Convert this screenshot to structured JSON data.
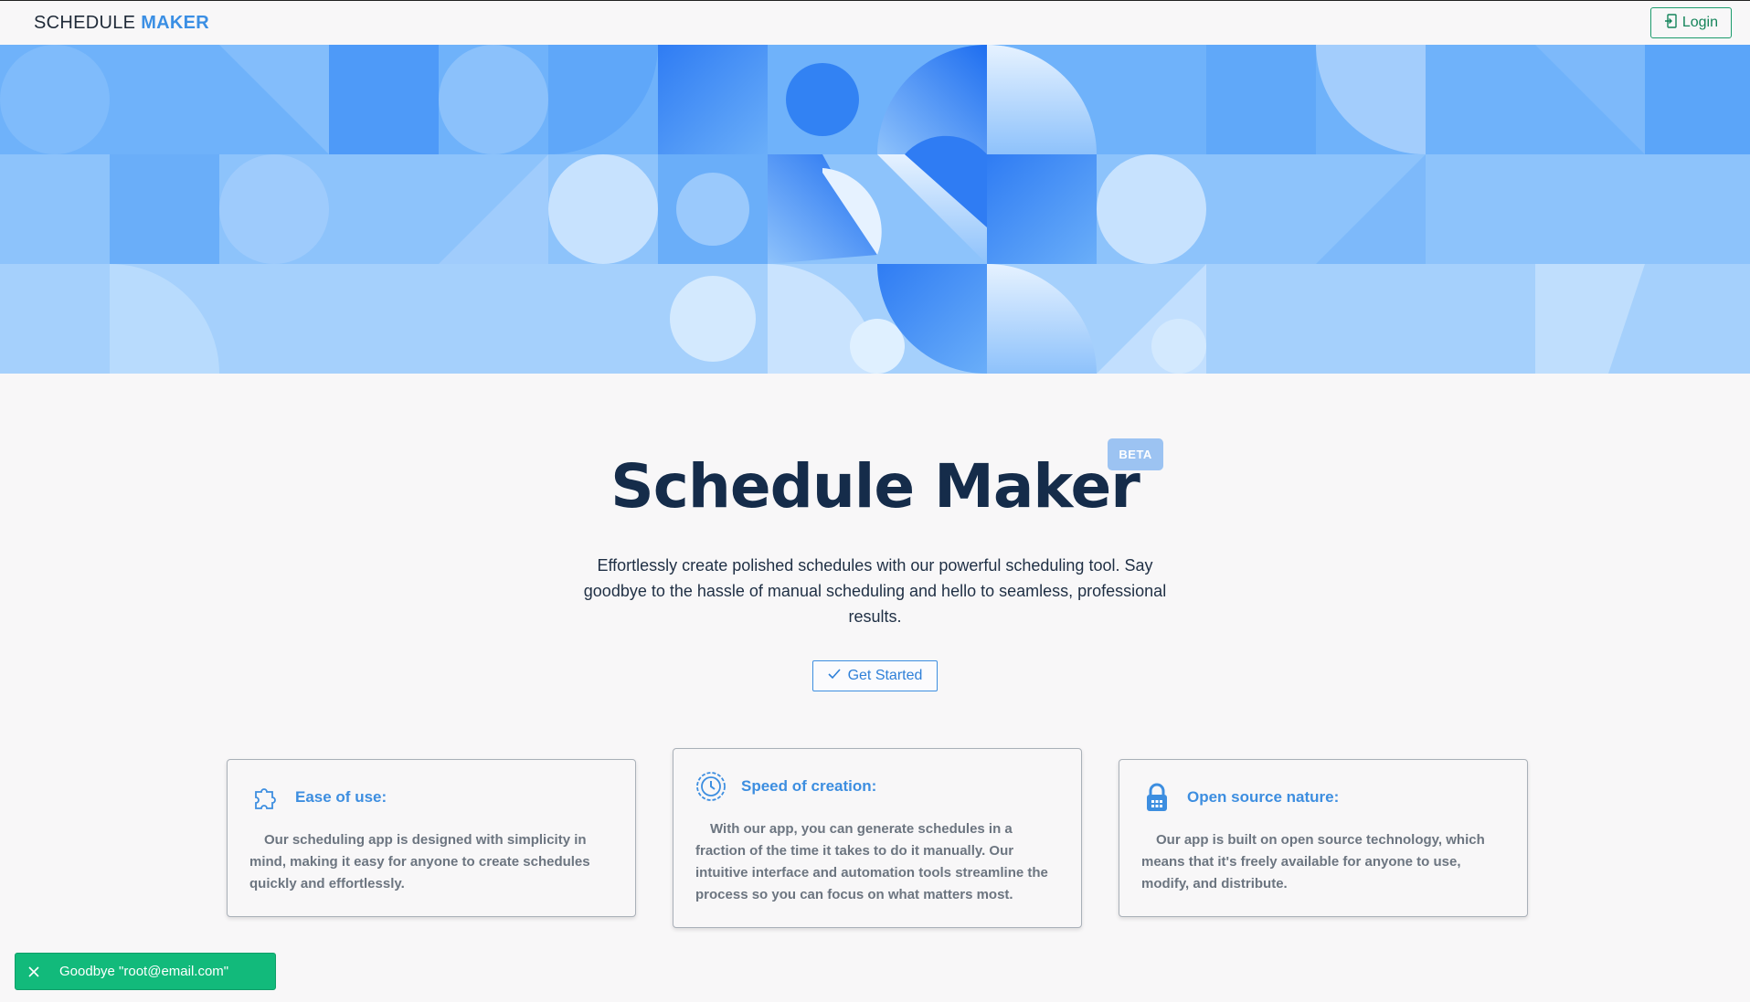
{
  "navbar": {
    "brand_plain": "SCHEDULE",
    "brand_accent": "MAKER",
    "login_label": "Login",
    "login_icon": "login-icon"
  },
  "hero": {
    "title": "Schedule Maker",
    "badge": "BETA",
    "subtitle": "Effortlessly create polished schedules with our powerful scheduling tool. Say goodbye to the hassle of manual scheduling and hello to seamless, professional results.",
    "cta_label": "Get Started",
    "cta_icon": "checkmark-icon"
  },
  "features": [
    {
      "icon": "puzzle-icon",
      "title": "Ease of use:",
      "body": "Our scheduling app is designed with simplicity in mind, making it easy for anyone to create schedules quickly and effortlessly."
    },
    {
      "icon": "clock-gear-icon",
      "title": "Speed of creation:",
      "body": "With our app, you can generate schedules in a fraction of the time it takes to do it manually. Our intuitive interface and automation tools streamline the process so you can focus on what matters most."
    },
    {
      "icon": "lock-icon",
      "title": "Open source nature:",
      "body": "Our app is built on open source technology, which means that it's freely available for anyone to use, modify, and distribute."
    }
  ],
  "toast": {
    "message": "Goodbye \"root@email.com\"",
    "close_icon": "close-icon"
  },
  "colors": {
    "accent": "#3b8fe4",
    "success": "#12ba7b",
    "title": "#152c4a"
  }
}
